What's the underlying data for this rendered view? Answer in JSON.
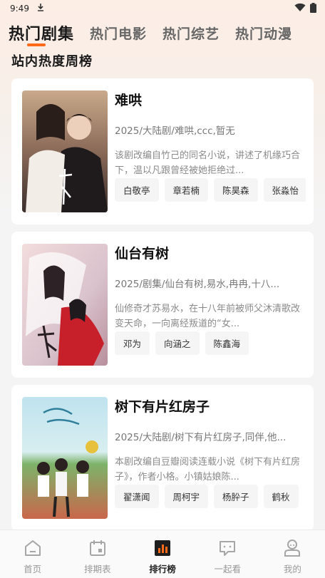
{
  "status_bar": {
    "time": "9:49",
    "download_icon": "download-icon",
    "wifi_icon": "wifi-icon",
    "battery_icon": "battery-icon"
  },
  "tabs": [
    {
      "label": "热门剧集",
      "active": true
    },
    {
      "label": "热门电影",
      "active": false
    },
    {
      "label": "热门综艺",
      "active": false
    },
    {
      "label": "热门动漫",
      "active": false
    }
  ],
  "accent_color": "#ff6a1a",
  "section_title": "站内热度周榜",
  "cards": [
    {
      "title": "难哄",
      "meta": "2025/大陆剧/难哄,ccc,暂无",
      "desc": "该剧改编自竹己的同名小说，讲述了机缘巧合下，温以凡跟曾经被她拒绝过...",
      "actors": [
        "白敬亭",
        "章若楠",
        "陈昊森",
        "张淼怡"
      ]
    },
    {
      "title": "仙台有树",
      "meta": "2025/剧集/仙台有树,易水,冉冉,十八...",
      "desc": "仙修奇才苏易水，在十八年前被师父沐清歌改变天命，一向离经叛道的“女...",
      "actors": [
        "邓为",
        "向涵之",
        "陈鑫海"
      ]
    },
    {
      "title": "树下有片红房子",
      "meta": "2025/大陆剧/树下有片红房子,同伴,他...",
      "desc": "本剧改编自豆瓣阅读连载小说《树下有片红房子》，作者小格。小镇姑娘陈...",
      "actors": [
        "翟潇闻",
        "周柯宇",
        "杨肸子",
        "鹤秋"
      ]
    }
  ],
  "bottom_nav": [
    {
      "label": "首页",
      "icon": "home-icon",
      "active": false
    },
    {
      "label": "排期表",
      "icon": "calendar-icon",
      "active": false
    },
    {
      "label": "排行榜",
      "icon": "ranking-icon",
      "active": true
    },
    {
      "label": "一起看",
      "icon": "chat-icon",
      "active": false
    },
    {
      "label": "我的",
      "icon": "profile-icon",
      "active": false
    }
  ]
}
